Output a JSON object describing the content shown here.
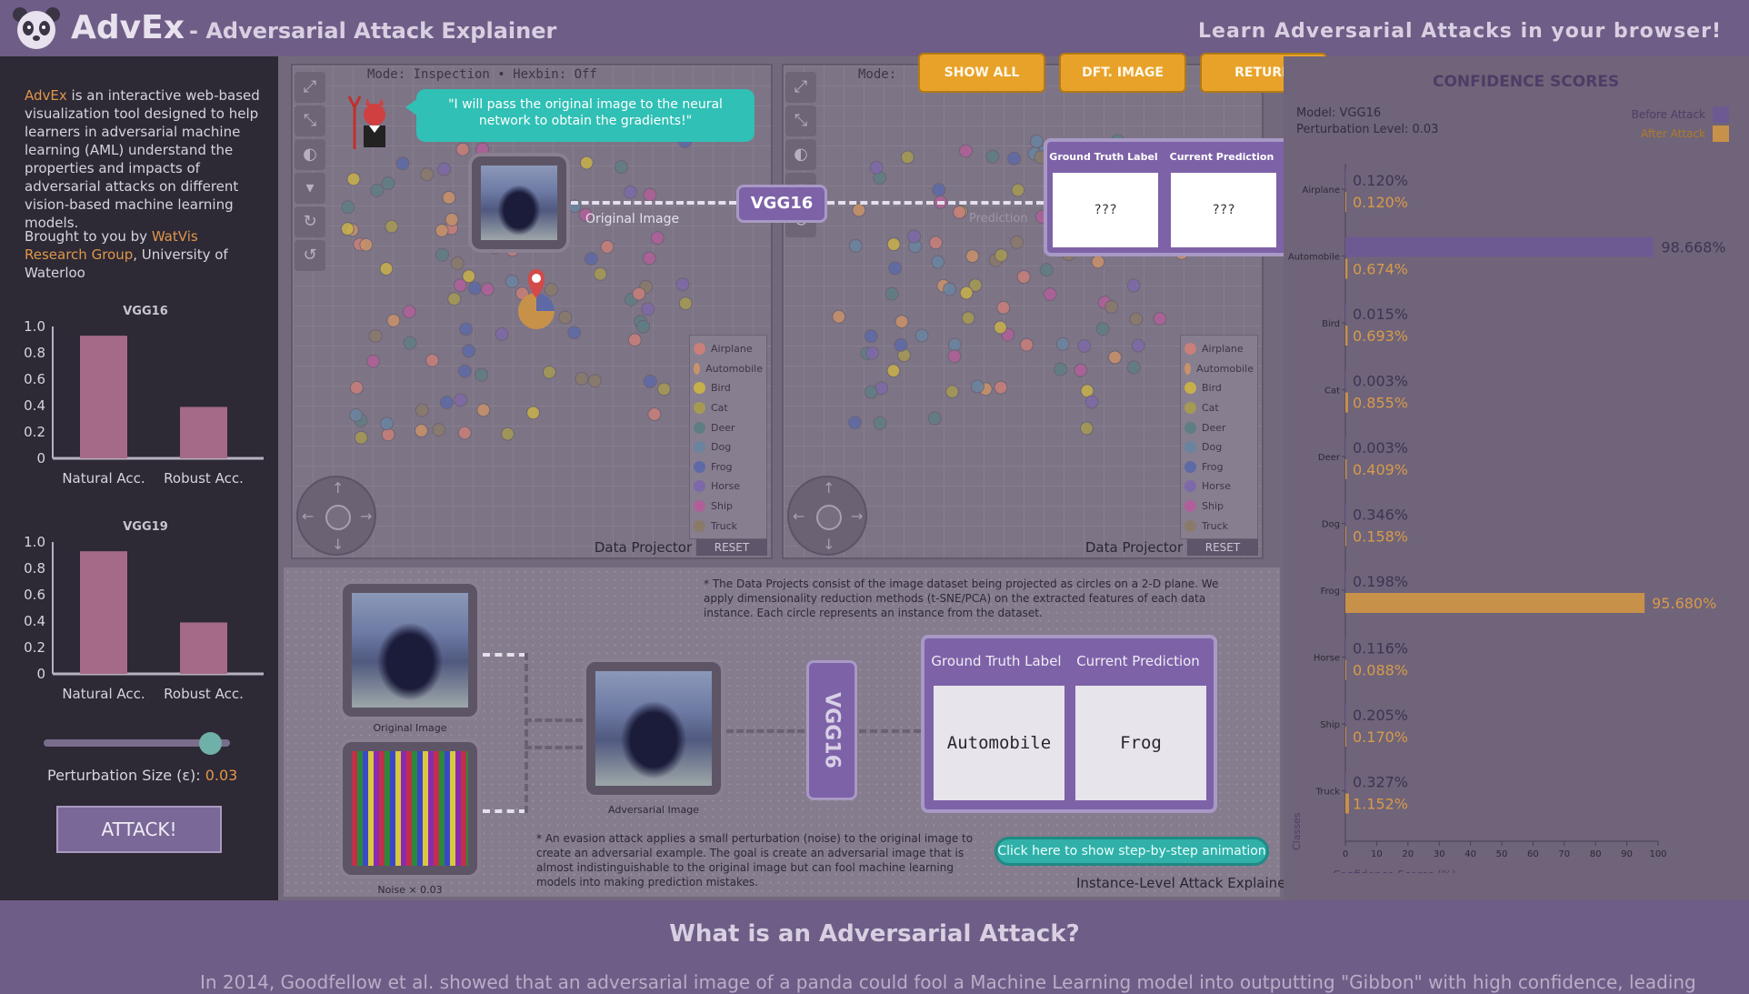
{
  "header": {
    "app_name": "AdvEx",
    "app_subtitle": "- Adversarial Attack Explainer",
    "tagline": "Learn Adversarial Attacks in your browser!"
  },
  "sidebar": {
    "intro_name": "AdvEx",
    "intro_text": " is an interactive web-based visualization tool designed to help learners in adversarial machine learning (AML) understand the properties and impacts of adversarial attacks on different vision-based machine learning models.",
    "credit_prefix": "Brought to you by ",
    "credit_link": "WatVis Research Group",
    "credit_suffix": ", University of Waterloo",
    "perturbation_label": "Perturbation Size (ε): ",
    "perturbation_value": "0.03",
    "perturbation_fraction": 0.95,
    "attack_button": "ATTACK!"
  },
  "mini_charts": [
    {
      "title": "VGG16",
      "categories": [
        "Natural Acc.",
        "Robust Acc."
      ],
      "values": [
        0.93,
        0.39
      ],
      "yticks": [
        "0",
        "0.2",
        "0.4",
        "0.6",
        "0.8",
        "1.0"
      ]
    },
    {
      "title": "VGG19",
      "categories": [
        "Natural Acc.",
        "Robust Acc."
      ],
      "values": [
        0.93,
        0.39
      ],
      "yticks": [
        "0",
        "0.2",
        "0.4",
        "0.6",
        "0.8",
        "1.0"
      ]
    }
  ],
  "toolbar": {
    "show_all": "SHOW ALL",
    "default_image": "DFT. IMAGE",
    "return": "RETURN"
  },
  "projectors": [
    {
      "mode": "Mode: Inspection • Hexbin: Off",
      "title": "Data Projector #1",
      "reset": "RESET"
    },
    {
      "mode": "Mode:",
      "title": "Data Projector #2",
      "reset": "RESET"
    }
  ],
  "legend_classes": [
    {
      "name": "Airplane",
      "color": "#c97f7a"
    },
    {
      "name": "Automobile",
      "color": "#c9926a"
    },
    {
      "name": "Bird",
      "color": "#c7b04a"
    },
    {
      "name": "Cat",
      "color": "#a59a52"
    },
    {
      "name": "Deer",
      "color": "#5f7e84"
    },
    {
      "name": "Dog",
      "color": "#6a84a0"
    },
    {
      "name": "Frog",
      "color": "#5d6aa6"
    },
    {
      "name": "Horse",
      "color": "#7d69a8"
    },
    {
      "name": "Ship",
      "color": "#b06098"
    },
    {
      "name": "Truck",
      "color": "#8a7a6a"
    }
  ],
  "overlay": {
    "speech": "\"I will pass the original image to the neural network to obtain the gradients!\"",
    "original_image_label": "Original Image",
    "model_chip": "VGG16",
    "prediction_faint": "Prediction",
    "gt_header": "Ground Truth Label",
    "pred_header": "Current Prediction",
    "gt_value": "???",
    "pred_value": "???"
  },
  "explainer": {
    "projects_note": "* The Data Projects consist of the image dataset being projected as circles on a 2-D plane. We apply dimensionality reduction methods (t-SNE/PCA) on the extracted features of each data instance. Each circle represents an instance from the dataset.",
    "original_caption": "Original Image",
    "noise_caption": "Noise × 0.03",
    "adversarial_caption": "Adversarial Image",
    "model_label": "VGG16",
    "gt_header": "Ground Truth Label",
    "pred_header": "Current Prediction",
    "gt_value": "Automobile",
    "pred_value": "Frog",
    "evasion_note": "* An evasion attack applies a small perturbation (noise) to the original image to create an adversarial example. The goal is create an adversarial image that is almost indistinguishable to the original image but can fool machine learning models into making prediction mistakes.",
    "animation_button": "Click here to show step-by-step animation",
    "title": "Instance-Level Attack Explainer"
  },
  "confidence": {
    "title": "CONFIDENCE SCORES",
    "model": "Model: VGG16",
    "perturbation": "Perturbation Level: 0.03",
    "legend_before": "Before Attack",
    "legend_after": "After Attack",
    "color_before": "#6e5a92",
    "color_after": "#c8914a",
    "xlabel": "Confidence Scores (%)",
    "ylabel": "Classes",
    "xticks": [
      "0",
      "10",
      "20",
      "30",
      "40",
      "50",
      "60",
      "70",
      "80",
      "90",
      "100"
    ]
  },
  "chart_data": {
    "type": "bar",
    "title": "CONFIDENCE SCORES",
    "categories": [
      "Airplane",
      "Automobile",
      "Bird",
      "Cat",
      "Deer",
      "Dog",
      "Frog",
      "Horse",
      "Ship",
      "Truck"
    ],
    "series": [
      {
        "name": "Before Attack",
        "values": [
          0.12,
          98.668,
          0.015,
          0.003,
          0.003,
          0.346,
          0.198,
          0.116,
          0.205,
          0.327
        ],
        "labels": [
          "0.120%",
          "98.668%",
          "0.015%",
          "0.003%",
          "0.003%",
          "0.346%",
          "0.198%",
          "0.116%",
          "0.205%",
          "0.327%"
        ]
      },
      {
        "name": "After Attack",
        "values": [
          0.12,
          0.674,
          0.693,
          0.855,
          0.409,
          0.158,
          95.68,
          0.088,
          0.17,
          1.152
        ],
        "labels": [
          "0.120%",
          "0.674%",
          "0.693%",
          "0.855%",
          "0.409%",
          "0.158%",
          "95.680%",
          "0.088%",
          "0.170%",
          "1.152%"
        ]
      }
    ],
    "xlabel": "Confidence Scores (%)",
    "ylabel": "Classes",
    "xlim": [
      0,
      100
    ],
    "legend": "top-right"
  },
  "footer": {
    "question": "What is an Adversarial Attack?",
    "text": "In 2014, Goodfellow et al. showed that an adversarial image of a panda could fool a Machine Learning model into outputting \"Gibbon\" with high confidence, leading"
  }
}
